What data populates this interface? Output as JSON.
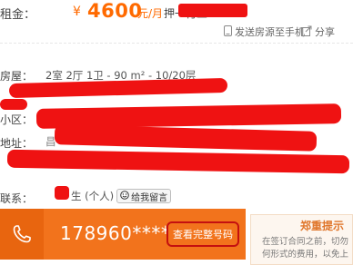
{
  "colors": {
    "accent_orange": "#f2731c",
    "price_orange": "#ff6a00",
    "redaction_red": "#ef1212",
    "button_border_red": "#c41010"
  },
  "price": {
    "label": "租金：",
    "currency": "¥",
    "amount": "4600",
    "unit": "元/月",
    "payment": "押一付三"
  },
  "actions": {
    "send_to_phone": "发送房源至手机",
    "share": "分享",
    "send_icon": "phone-icon",
    "share_icon": "share-icon"
  },
  "details": {
    "layout_label": "房屋：",
    "layout_value": "2室 2厅 1卫  -  90 m²  -  10/20层",
    "community_label": "小区：",
    "address_label": "地址：",
    "address_partial": "昌"
  },
  "contact": {
    "label": "联系：",
    "name_suffix": "生 (个人)",
    "message_button": "给我留言",
    "message_icon": "smiley-icon"
  },
  "phone": {
    "icon": "phone-handset-icon",
    "number": "178960****9",
    "view_button": "查看完整号码"
  },
  "notice": {
    "title": "郑重提示",
    "line1": "在签订合同之前，切勿",
    "line2": "何形式的费用，以免上"
  }
}
